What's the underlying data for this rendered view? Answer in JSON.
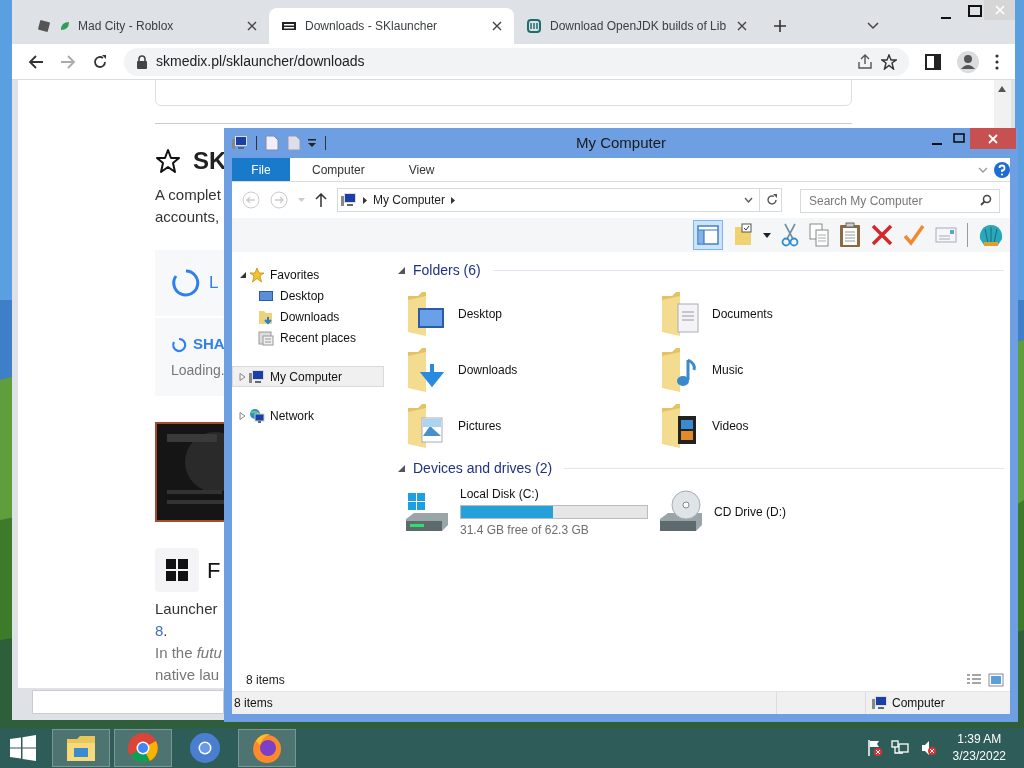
{
  "browser": {
    "tabs": [
      {
        "title": "Mad City - Roblox",
        "selected": false
      },
      {
        "title": "Downloads - SKlauncher",
        "selected": true
      },
      {
        "title": "Download OpenJDK builds of Lib",
        "selected": false
      }
    ],
    "url": "skmedix.pl/sklauncher/downloads"
  },
  "page": {
    "heading": "SK",
    "intro": [
      "A complet",
      "accounts,"
    ],
    "loading_cards": [
      {
        "label": "L"
      },
      {
        "label": "SHA",
        "status": "Loading."
      }
    ],
    "banner": {
      "kind": "picture"
    },
    "section_heading": "F",
    "lines": [
      {
        "text": "Launcher"
      },
      {
        "link": "8",
        "text": "."
      },
      {
        "text": "In the *futu*"
      },
      {
        "text": "native lau"
      }
    ]
  },
  "explorer": {
    "title": "My Computer",
    "ribbon_tabs": [
      {
        "label": "File",
        "selected": true
      },
      {
        "label": "Computer",
        "selected": false
      },
      {
        "label": "View",
        "selected": false
      }
    ],
    "address": "My Computer",
    "search": {
      "placeholder": "Search My Computer"
    },
    "nav": [
      {
        "label": "Favorites",
        "expanded": true,
        "selected": false,
        "children": [
          {
            "label": "Desktop",
            "selected": false
          },
          {
            "label": "Downloads",
            "selected": false
          },
          {
            "label": "Recent places",
            "selected": false
          }
        ]
      },
      {
        "label": "My Computer",
        "expanded": false,
        "selected": true
      },
      {
        "label": "Network",
        "expanded": false,
        "selected": false
      }
    ],
    "groups": [
      {
        "title": "Folders (6)",
        "items": [
          {
            "kind": "folder",
            "name": "Desktop"
          },
          {
            "kind": "folder",
            "name": "Documents"
          },
          {
            "kind": "folder",
            "name": "Downloads"
          },
          {
            "kind": "folder",
            "name": "Music"
          },
          {
            "kind": "folder",
            "name": "Pictures"
          },
          {
            "kind": "folder",
            "name": "Videos"
          }
        ]
      },
      {
        "title": "Devices and drives (2)",
        "items": [
          {
            "kind": "disk",
            "name": "Local Disk (C:)",
            "level": 0.496,
            "info": "31.4 GB free of 62.3 GB"
          },
          {
            "kind": "cd",
            "name": "CD Drive (D:)"
          }
        ]
      }
    ],
    "item_count": "8 items",
    "status": {
      "count": "8 items",
      "location": "Computer"
    }
  },
  "taskbar": {
    "time": "1:39 AM",
    "date": "3/23/2022"
  }
}
